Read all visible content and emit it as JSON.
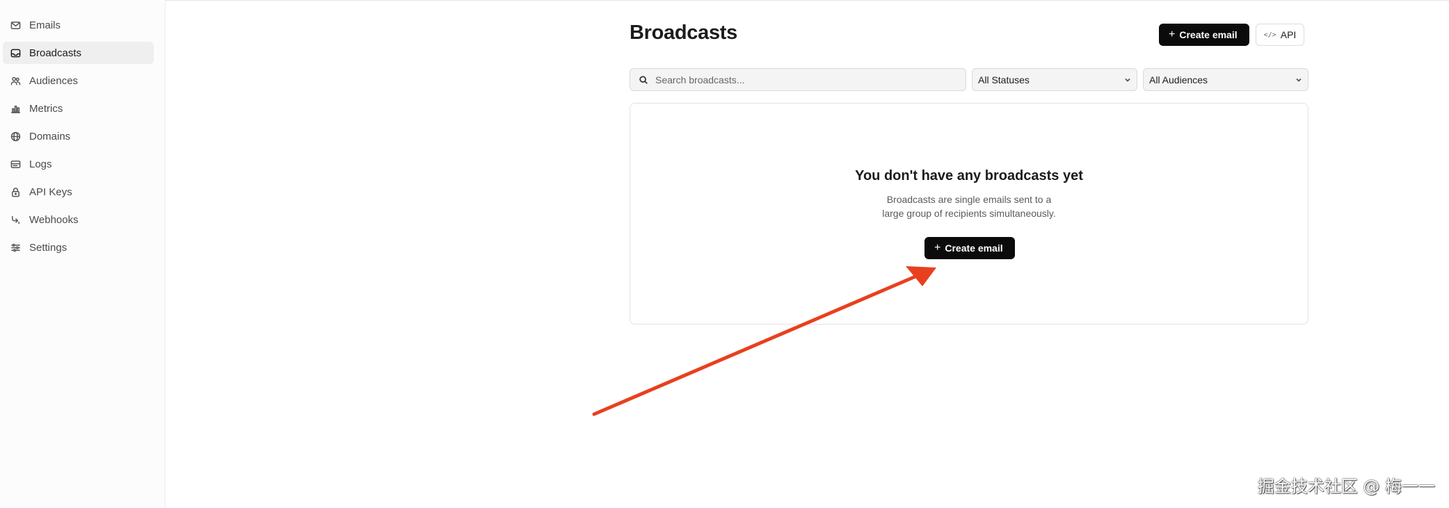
{
  "sidebar": {
    "items": [
      {
        "label": "Emails",
        "icon": "mail-icon",
        "active": false
      },
      {
        "label": "Broadcasts",
        "icon": "inbox-icon",
        "active": true
      },
      {
        "label": "Audiences",
        "icon": "users-icon",
        "active": false
      },
      {
        "label": "Metrics",
        "icon": "bar-chart-icon",
        "active": false
      },
      {
        "label": "Domains",
        "icon": "globe-icon",
        "active": false
      },
      {
        "label": "Logs",
        "icon": "logs-icon",
        "active": false
      },
      {
        "label": "API Keys",
        "icon": "lock-icon",
        "active": false
      },
      {
        "label": "Webhooks",
        "icon": "webhook-icon",
        "active": false
      },
      {
        "label": "Settings",
        "icon": "sliders-icon",
        "active": false
      }
    ]
  },
  "header": {
    "title": "Broadcasts",
    "create_label": "Create email",
    "api_label": "API"
  },
  "filters": {
    "search_placeholder": "Search broadcasts...",
    "status_value": "All Statuses",
    "audience_value": "All Audiences"
  },
  "empty_state": {
    "title": "You don't have any broadcasts yet",
    "description_line1": "Broadcasts are single emails sent to a",
    "description_line2": "large group of recipients simultaneously.",
    "create_label": "Create email"
  },
  "annotation": {
    "arrow_color": "#e8401f"
  },
  "watermark": "掘金技术社区 @ 梅一一",
  "colors": {
    "primary_button": "#0b0b0b",
    "active_nav_bg": "#efefef"
  }
}
